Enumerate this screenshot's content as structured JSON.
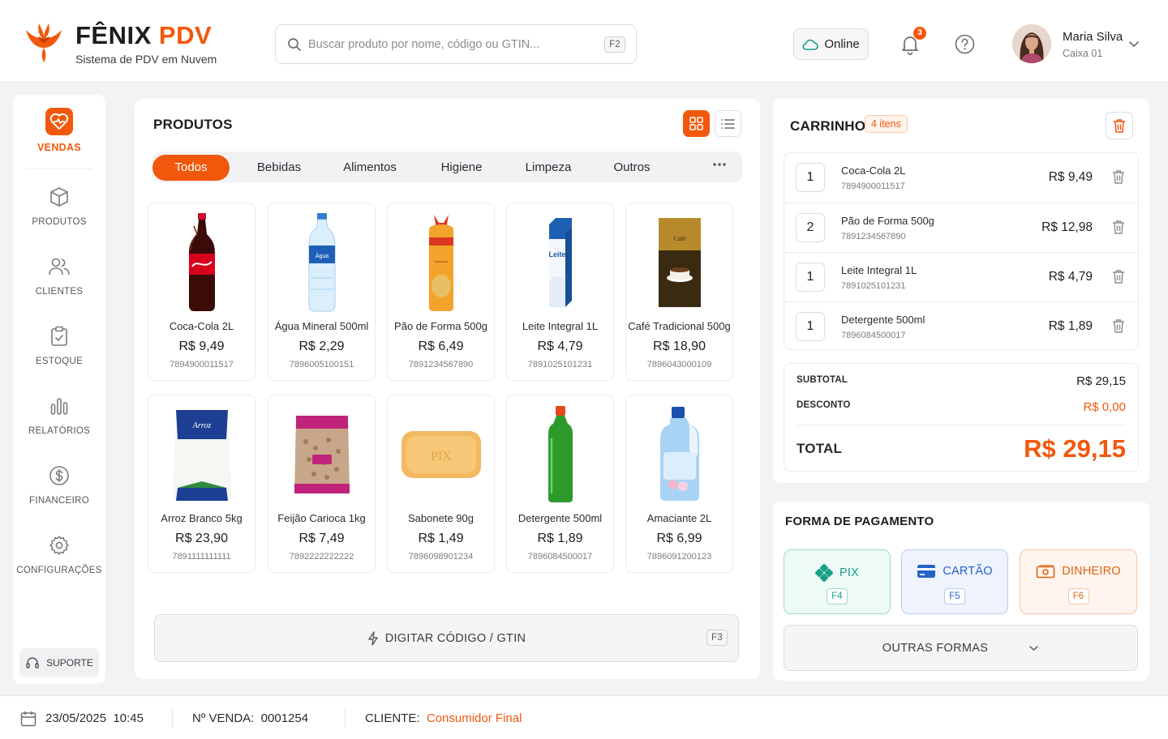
{
  "brand": {
    "name_prefix": "FÊNIX",
    "name_accent": "PDV",
    "subtitle": "Sistema de PDV em Nuvem",
    "accent_color": "#f2580c",
    "logo_icon": "phoenix-logo-icon"
  },
  "search": {
    "placeholder": "Buscar produto por nome, código ou GTIN...",
    "shortcut": "F2",
    "icon": "search-icon"
  },
  "header": {
    "status_label": "Online",
    "status_icon": "cloud-icon",
    "notifications_count": "3",
    "help_icon": "help-circle-icon"
  },
  "user": {
    "name": "Maria Silva",
    "role": "Caixa 01"
  },
  "sidebar": {
    "items": [
      {
        "label": "VENDAS",
        "icon": "sales-tag-icon",
        "active": true
      },
      {
        "label": "PRODUTOS",
        "icon": "box-icon"
      },
      {
        "label": "CLIENTES",
        "icon": "users-icon"
      },
      {
        "label": "ESTOQUE",
        "icon": "clipboard-icon"
      },
      {
        "label": "RELATÓRIOS",
        "icon": "bar-chart-icon"
      },
      {
        "label": "FINANCEIRO",
        "icon": "dollar-circle-icon"
      },
      {
        "label": "CONFIGURAÇÕES",
        "icon": "gear-icon"
      }
    ],
    "support_label": "SUPORTE"
  },
  "products": {
    "title": "PRODUTOS",
    "tabs": [
      "Todos",
      "Bebidas",
      "Alimentos",
      "Higiene",
      "Limpeza",
      "Outros"
    ],
    "active_tab": "Todos",
    "items": [
      {
        "name": "Coca-Cola 2L",
        "price": "R$ 9,49",
        "code": "7894900011517"
      },
      {
        "name": "Água Mineral 500ml",
        "price": "R$ 2,29",
        "code": "7896005100151"
      },
      {
        "name": "Pão de Forma 500g",
        "price": "R$ 6,49",
        "code": "7891234567890"
      },
      {
        "name": "Leite Integral 1L",
        "price": "R$ 4,79",
        "code": "7891025101231"
      },
      {
        "name": "Café Tradicional 500g",
        "price": "R$ 18,90",
        "code": "7896043000109"
      },
      {
        "name": "Arroz Branco 5kg",
        "price": "R$ 23,90",
        "code": "7891111111111"
      },
      {
        "name": "Feijão Carioca 1kg",
        "price": "R$ 7,49",
        "code": "7892222222222"
      },
      {
        "name": "Sabonete 90g",
        "price": "R$ 1,49",
        "code": "7896098901234"
      },
      {
        "name": "Detergente 500ml",
        "price": "R$ 1,89",
        "code": "7896084500017"
      },
      {
        "name": "Amaciante 2L",
        "price": "R$ 6,99",
        "code": "7896091200123"
      }
    ],
    "code_entry_label": "DIGITAR CÓDIGO / GTIN",
    "code_entry_shortcut": "F3"
  },
  "cart": {
    "title": "CARRINHO",
    "count_label": "4 itens",
    "items": [
      {
        "qty": "1",
        "name": "Coca-Cola 2L",
        "code": "7894900011517",
        "price": "R$ 9,49"
      },
      {
        "qty": "2",
        "name": "Pão de Forma 500g",
        "code": "7891234567890",
        "price": "R$ 12,98"
      },
      {
        "qty": "1",
        "name": "Leite Integral 1L",
        "code": "7891025101231",
        "price": "R$ 4,79"
      },
      {
        "qty": "1",
        "name": "Detergente 500ml",
        "code": "7896084500017",
        "price": "R$ 1,89"
      }
    ],
    "subtotal_label": "SUBTOTAL",
    "subtotal": "R$ 29,15",
    "discount_label": "DESCONTO",
    "discount": "R$ 0,00",
    "total_label": "TOTAL",
    "total": "R$ 29,15"
  },
  "payment": {
    "title": "FORMA DE PAGAMENTO",
    "methods": [
      {
        "label": "PIX",
        "key": "F4",
        "color": "#16a085",
        "icon": "pix-icon"
      },
      {
        "label": "CARTÃO",
        "key": "F5",
        "color": "#2563c9",
        "icon": "credit-card-icon"
      },
      {
        "label": "DINHEIRO",
        "key": "F6",
        "color": "#e0620f",
        "icon": "cash-icon"
      }
    ],
    "other_label": "OUTRAS FORMAS"
  },
  "footer": {
    "date": "23/05/2025",
    "time": "10:45",
    "sale_label": "Nº VENDA:",
    "sale_number": "0001254",
    "client_label": "CLIENTE:",
    "client_value": "Consumidor Final"
  }
}
